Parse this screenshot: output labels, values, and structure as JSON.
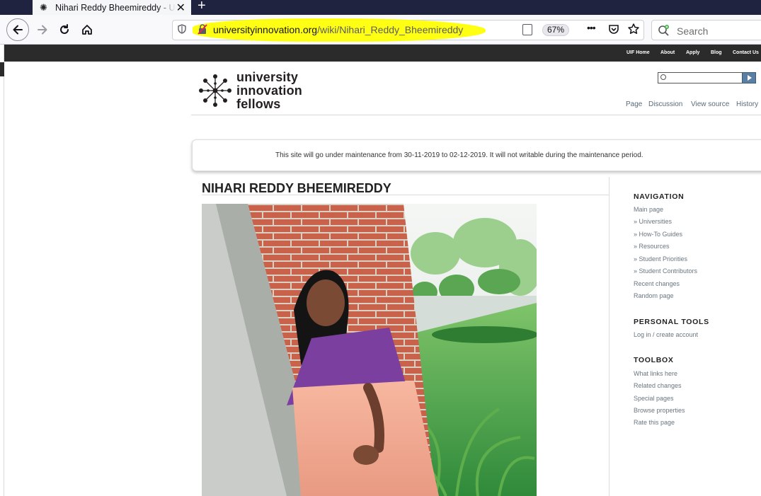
{
  "browser": {
    "tab_title": "Nihari Reddy Bheemireddy - University Innovation Fellows",
    "tab_close": "✕",
    "new_tab": "+",
    "url_domain": "universityinnovation.org",
    "url_path": "/wiki/Nihari_Reddy_Bheemireddy",
    "zoom_level": "67%",
    "search_placeholder": "Search",
    "more_icon": "•••",
    "icons": [
      "favicon-icon",
      "back-arrow-icon",
      "forward-arrow-icon",
      "reload-icon",
      "home-icon",
      "shield-icon",
      "insecure-lock-icon",
      "reader-view-icon",
      "pocket-icon",
      "bookmark-star-icon",
      "search-engine-icon"
    ],
    "highlight_color": "#ffff00"
  },
  "site": {
    "top_links": [
      "UIF Home",
      "About",
      "Apply",
      "Blog",
      "Contact Us"
    ],
    "logo_lines": [
      "university",
      "innovation",
      "fellows"
    ],
    "page_tabs": [
      "Page",
      "Discussion",
      "View source",
      "History"
    ],
    "notice": "This site will go under maintenance from 30-11-2019 to 02-12-2019. It will not writable during the maintenance period.",
    "page_title": "NIHARI REDDY BHEEMIREDDY",
    "navigation": {
      "heading": "NAVIGATION",
      "items": [
        "Main page",
        "» Universities",
        "» How-To Guides",
        "» Resources",
        "» Student Priorities",
        "» Student Contributors",
        "Recent changes",
        "Random page"
      ]
    },
    "personal_tools": {
      "heading": "PERSONAL TOOLS",
      "items": [
        "Log in / create account"
      ]
    },
    "toolbox": {
      "heading": "TOOLBOX",
      "items": [
        "What links here",
        "Related changes",
        "Special pages",
        "Browse properties",
        "Rate this page"
      ]
    }
  }
}
